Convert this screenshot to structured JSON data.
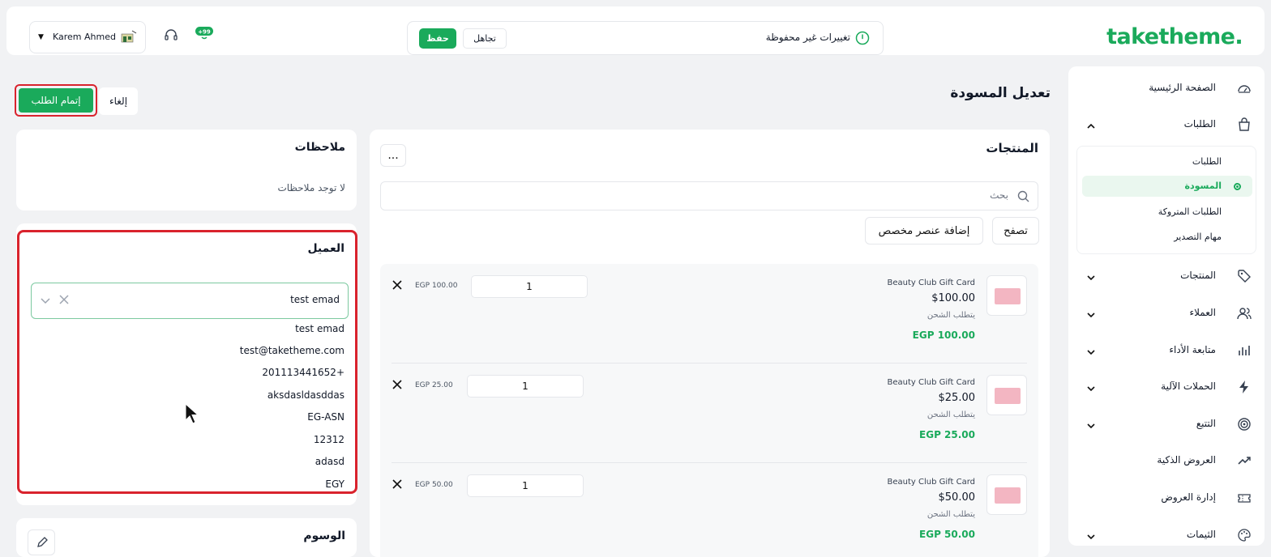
{
  "header": {
    "logo": "taketheme.",
    "unsaved_text": "تغييرات غير محفوظة",
    "save_label": "حفظ",
    "ignore_label": "تجاهل",
    "user_name": "Karem Ahmed",
    "badge_count": "+99"
  },
  "sidebar": {
    "items": [
      {
        "label": "الصفحة الرئيسية",
        "icon": "dashboard-icon"
      },
      {
        "label": "الطلبات",
        "icon": "shopping-bag-icon",
        "expanded": true
      },
      {
        "label": "المنتجات",
        "icon": "tag-icon"
      },
      {
        "label": "العملاء",
        "icon": "users-icon"
      },
      {
        "label": "متابعة الأداء",
        "icon": "bar-chart-icon"
      },
      {
        "label": "الحملات الآلية",
        "icon": "lightning-icon"
      },
      {
        "label": "التتبع",
        "icon": "target-icon"
      },
      {
        "label": "العروض الذكية",
        "icon": "trending-icon"
      },
      {
        "label": "إدارة العروض",
        "icon": "ticket-icon"
      },
      {
        "label": "الثيمات",
        "icon": "palette-icon"
      }
    ],
    "orders_sub": [
      {
        "label": "الطلبات"
      },
      {
        "label": "المسودة",
        "active": true
      },
      {
        "label": "الطلبات المتروكة"
      },
      {
        "label": "مهام التصدير"
      }
    ]
  },
  "page": {
    "title": "تعديل المسودة",
    "complete_label": "إتمام الطلب",
    "cancel_label": "إلغاء"
  },
  "products": {
    "title": "المنتجات",
    "more_label": "...",
    "search_placeholder": "بحث",
    "browse_label": "تصفح",
    "custom_label": "إضافة عنصر مخصص",
    "items": [
      {
        "name": "Beauty Club Gift Card",
        "price": "$100.00",
        "shipping": "يتطلب الشحن",
        "total": "EGP 100.00",
        "qty": "1",
        "line_total": "EGP 100.00"
      },
      {
        "name": "Beauty Club Gift Card",
        "price": "$25.00",
        "shipping": "يتطلب الشحن",
        "total": "EGP 25.00",
        "qty": "1",
        "line_total": "EGP 25.00"
      },
      {
        "name": "Beauty Club Gift Card",
        "price": "$50.00",
        "shipping": "يتطلب الشحن",
        "total": "EGP 50.00",
        "qty": "1",
        "line_total": "EGP 50.00"
      }
    ]
  },
  "notes": {
    "title": "ملاحظات",
    "empty": "لا توجد ملاحظات"
  },
  "customer": {
    "title": "العميل",
    "selected": "test emad",
    "details": [
      "test emad",
      "test@taketheme.com",
      "201113441652+",
      "aksdasldasddas",
      "EG-ASN",
      "12312",
      "adasd",
      "EGY"
    ]
  },
  "tags": {
    "title": "الوسوم"
  },
  "colors": {
    "brand": "#1aaa5b",
    "highlight": "#d9232d"
  }
}
